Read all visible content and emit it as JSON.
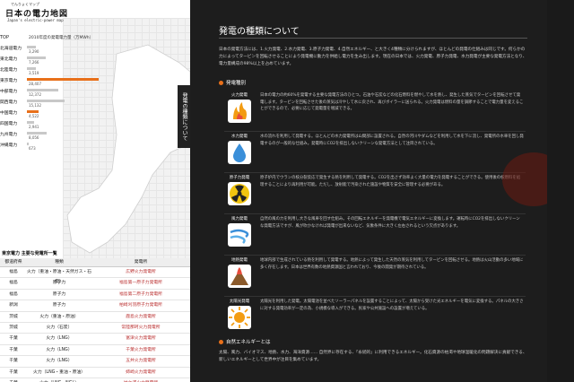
{
  "header": {
    "ruby": "でんりょくマップ",
    "title": "日本の電力地図",
    "subtitle": "Japan's electric-power map"
  },
  "chart": {
    "top_label": "TOP",
    "title": "2010年度の発電電力量（万MWh）"
  },
  "regions": [
    {
      "name": "北海道電力",
      "value": "3,290",
      "pct": 0.12,
      "highlight": false
    },
    {
      "name": "東北電力",
      "value": "7,266",
      "pct": 0.26,
      "highlight": false
    },
    {
      "name": "北陸電力",
      "value": "3,519",
      "pct": 0.13,
      "highlight": false
    },
    {
      "name": "東京電力",
      "value": "28,407",
      "pct": 1.0,
      "highlight": true
    },
    {
      "name": "中部電力",
      "value": "12,372",
      "pct": 0.44,
      "highlight": false
    },
    {
      "name": "関西電力",
      "value": "15,132",
      "pct": 0.53,
      "highlight": false
    },
    {
      "name": "中国電力",
      "value": "4,522",
      "pct": 0.16,
      "highlight": true
    },
    {
      "name": "四国電力",
      "value": "2,941",
      "pct": 0.1,
      "highlight": false
    },
    {
      "name": "九州電力",
      "value": "8,056",
      "pct": 0.28,
      "highlight": false
    },
    {
      "name": "沖縄電力",
      "value": "673",
      "pct": 0.03,
      "highlight": false
    }
  ],
  "plant_list": {
    "title": "東京電力 主要な発電所一覧",
    "headers": [
      "都道府県",
      "種類",
      "発電所"
    ],
    "rows": [
      [
        "福島",
        "火力（重油・原油・天然ガス・石炭）",
        "広野火力発電所"
      ],
      [
        "福島",
        "原子力",
        "福島第一原子力発電所"
      ],
      [
        "福島",
        "原子力",
        "福島第二原子力発電所"
      ],
      [
        "新潟",
        "原子力",
        "柏崎刈羽原子力発電所"
      ],
      [
        "茨城",
        "火力（重油・原油）",
        "鹿島火力発電所"
      ],
      [
        "茨城",
        "火力（石炭）",
        "常陸那珂火力発電所"
      ],
      [
        "千葉",
        "火力（LNG）",
        "富津火力発電所"
      ],
      [
        "千葉",
        "火力（LNG）",
        "千葉火力発電所"
      ],
      [
        "千葉",
        "火力（LNG）",
        "五井火力発電所"
      ],
      [
        "千葉",
        "火力（LNG・重油・原油）",
        "姉崎火力発電所"
      ],
      [
        "千葉",
        "火力（LNG・NGL）",
        "袖ケ浦火力発電所"
      ]
    ]
  },
  "tab": {
    "label": "発電の種類について"
  },
  "panel": {
    "title": "発電の種類について",
    "intro": "日本の発電方法には、1.火力発電、2.水力発電、3.原子力発電、4.自然エネルギー、と大きく4種類に分けられますが、ほとんどの発電の仕組みは同じです。何らかの力によってタービンを回転させることにより発電機に動力を供給し電力を生み出します。現在の日本では、火力発電、原子力発電、水力発電が主要な発電方法となり、電力量構成の98%以上を占めています。",
    "section1": "発電種別",
    "types": [
      {
        "name": "火力発電",
        "icon": "fire-icon",
        "desc": "日本の電力の約60%を発電する主要な発電方法のひとつ。石油や石炭などの化石燃料を燃やして水を熱し、発生した蒸気でタービンを回転させて発電します。タービンを回転させた後の蒸気は冷やして水に戻され、再びボイラーに送られる。火力発電は燃料の量を調節することで電力量を変えることができるので、必要に応じて発電量を増減できる。"
      },
      {
        "name": "水力発電",
        "icon": "water-drop-icon",
        "desc": "水の流れを利用して発電する。ほとんどの水力発電所は山間部に設置される。自然の河川やダムなどを利用して水を下に流し、発電所の水車を回し発電するのが一般的な仕組み。発電時にCO2を排出しないクリーンな発電方法として注目されている。"
      },
      {
        "name": "原子力発電",
        "icon": "radiation-icon",
        "desc": "原子炉内でウランの核分裂反応で発生する熱を利用して発電する。CO2を出さず効率よく大量の電力を発電することができる。使用後の核燃料を処理することにより再利用が可能。ただし、放射能で汚染された施設や物質を安全に管理する必要がある。"
      },
      {
        "name": "風力発電",
        "icon": "wind-icon",
        "desc": "自然の風の力を利用し大きな風車を回す仕組み。その回転エネルギーを発電機で電気エネルギーに変換します。運転時にCO2を排出しないクリーンな発電方法ですが、風が吹かなければ発電が出来ないなど、気象条件に大きく左右されるという欠点があります。"
      },
      {
        "name": "地熱発電",
        "icon": "volcano-icon",
        "desc": "地球内部で生成されている熱を利用して発電する。地熱によって発生した天然の蒸気を利用してタービンを回転させる。地熱は火山活動の多い地域に多く存在します。日本は世界有数の地熱資源国と言われており、今後の開発が期待されている。"
      },
      {
        "name": "太陽光発電",
        "icon": "sun-icon",
        "desc": "太陽光を利用した発電。太陽電池を並べたソーラーパネルを設置することによって、太陽から受けた光エネルギーを電気に変換する。パネルの大きさに対する発電効率が一定の為、小規模な導入ができる。民家や公共施設への設置が増えている。"
      }
    ],
    "section2": "自然エネルギーとは",
    "section2_text": "太陽、風力、バイオマス、地熱、水力、海洋資源…… 自然界に存在する、「永続的」に利用できるエネルギー。化石資源の枯渇や地球温暖化の問題解決に貢献できる、新しいエネルギーとして世界中が注目を集めています。"
  }
}
